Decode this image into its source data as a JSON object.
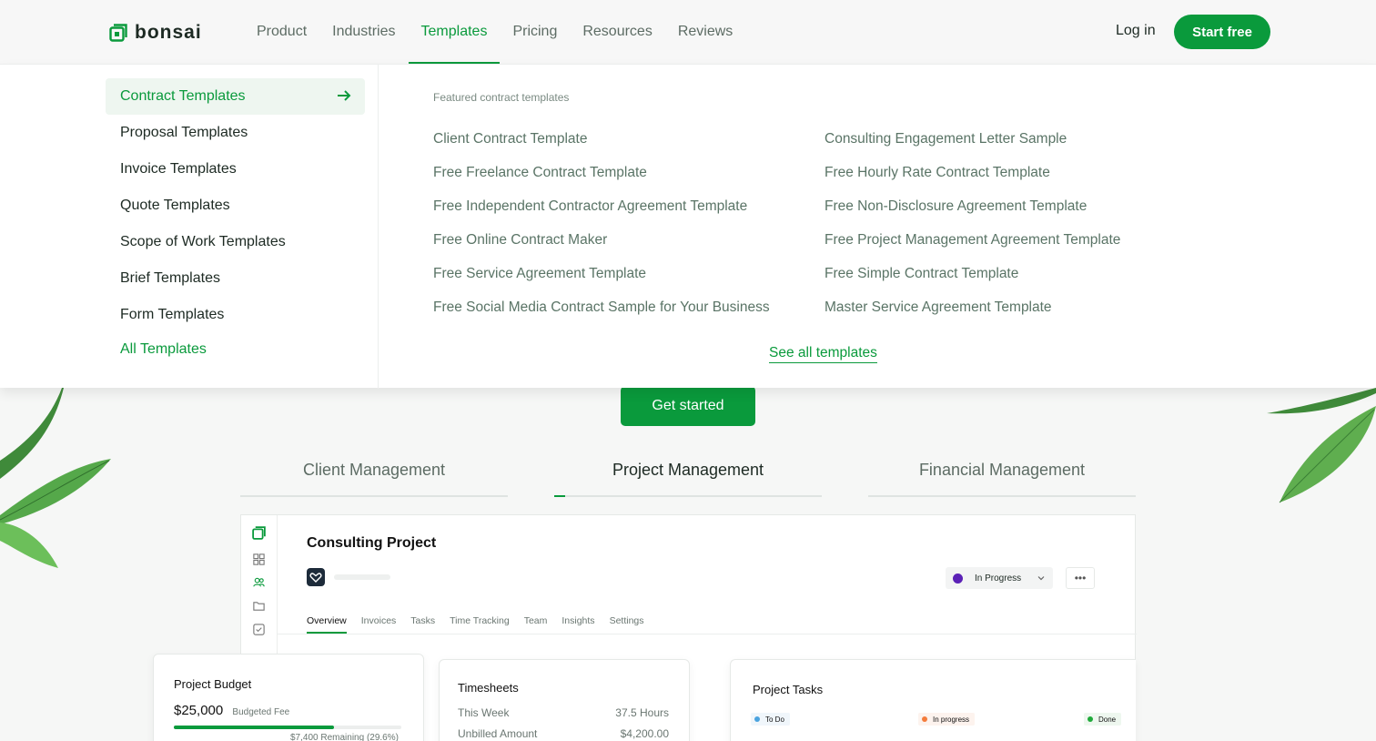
{
  "brand": {
    "name": "bonsai",
    "color": "#0a9a3c"
  },
  "nav": {
    "items": [
      {
        "label": "Product",
        "active": false
      },
      {
        "label": "Industries",
        "active": false
      },
      {
        "label": "Templates",
        "active": true
      },
      {
        "label": "Pricing",
        "active": false
      },
      {
        "label": "Resources",
        "active": false
      },
      {
        "label": "Reviews",
        "active": false
      }
    ],
    "login": "Log in",
    "start_free": "Start free"
  },
  "mega_menu": {
    "categories": [
      {
        "label": "Contract Templates"
      },
      {
        "label": "Proposal Templates"
      },
      {
        "label": "Invoice Templates"
      },
      {
        "label": "Quote Templates"
      },
      {
        "label": "Scope of Work Templates"
      },
      {
        "label": "Brief Templates"
      },
      {
        "label": "Form Templates"
      },
      {
        "label": "All Templates"
      }
    ],
    "featured_heading": "Featured contract templates",
    "links_col1": [
      "Client Contract Template",
      "Free Freelance Contract Template",
      "Free Independent Contractor Agreement Template",
      "Free Online Contract Maker",
      "Free Service Agreement Template",
      "Free Social Media Contract Sample for Your Business"
    ],
    "links_col2": [
      "Consulting Engagement Letter Sample",
      "Free Hourly Rate Contract Template",
      "Free Non-Disclosure Agreement Template",
      "Free Project Management Agreement Template",
      "Free Simple Contract Template",
      "Master Service Agreement Template"
    ],
    "see_all": "See all templates"
  },
  "hero": {
    "get_started": "Get started",
    "tabs": [
      {
        "label": "Client Management"
      },
      {
        "label": "Project Management"
      },
      {
        "label": "Financial Management"
      }
    ]
  },
  "dashboard": {
    "title": "Consulting Project",
    "status": "In Progress",
    "more": "•••",
    "subtabs": [
      "Overview",
      "Invoices",
      "Tasks",
      "Time Tracking",
      "Team",
      "Insights",
      "Settings"
    ],
    "budget": {
      "title": "Project Budget",
      "amount": "$25,000",
      "label": "Budgeted Fee",
      "progress": 0.704,
      "remaining": "$7,400 Remaining (29.6%)"
    },
    "timesheets": {
      "title": "Timesheets",
      "rows": [
        {
          "label": "This Week",
          "value": "37.5 Hours"
        },
        {
          "label": "Unbilled Amount",
          "value": "$4,200.00"
        }
      ]
    },
    "tasks": {
      "title": "Project Tasks",
      "columns": [
        {
          "label": "To Do",
          "color": "#4aa3df"
        },
        {
          "label": "In progress",
          "color": "#f47c3c"
        },
        {
          "label": "Done",
          "color": "#1faa3a"
        }
      ]
    }
  }
}
